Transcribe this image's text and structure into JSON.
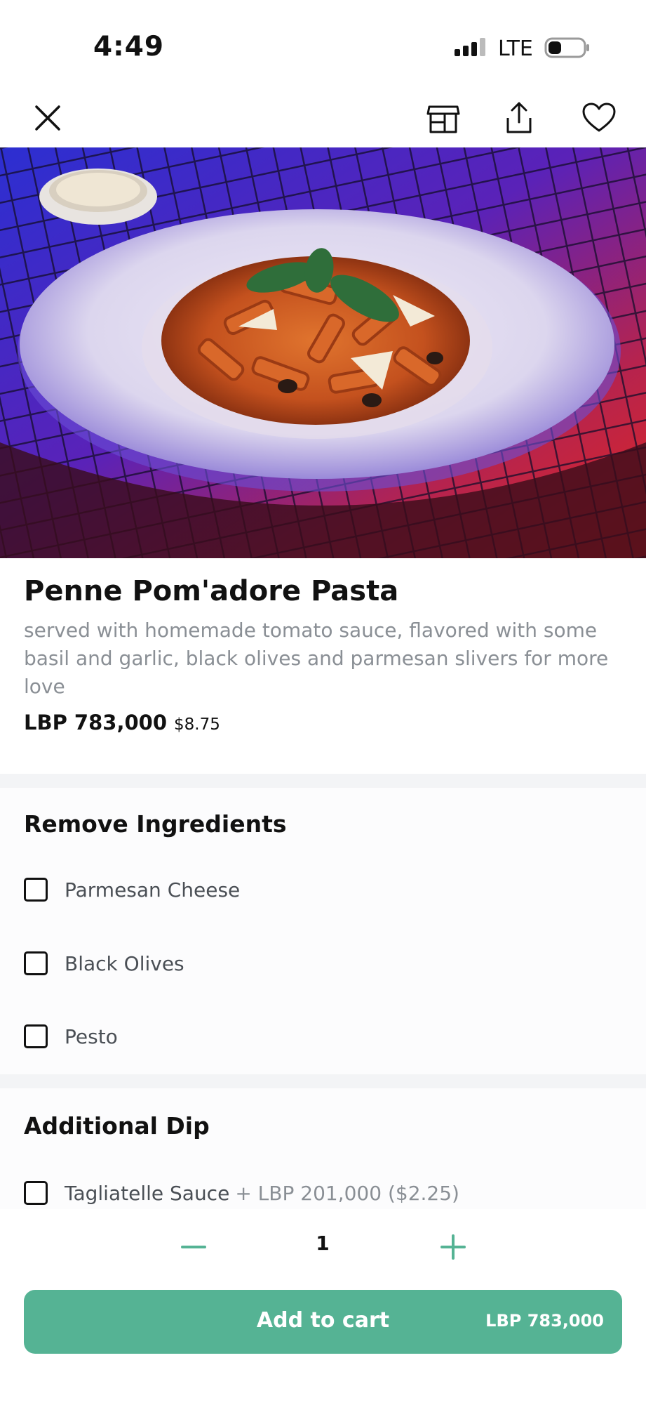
{
  "status_bar": {
    "time": "4:49",
    "network": "LTE"
  },
  "toolbar": {
    "close_icon": "close-icon",
    "store_icon": "store-icon",
    "share_icon": "share-icon",
    "favorite_icon": "heart-icon"
  },
  "item": {
    "title": "Penne Pom'adore Pasta",
    "description": "served with homemade tomato sauce, flavored with some basil and garlic, black olives and parmesan slivers for more love",
    "price_lbp": "LBP 783,000",
    "price_usd": "$8.75"
  },
  "remove_ingredients": {
    "title": "Remove Ingredients",
    "options": [
      {
        "label": "Parmesan Cheese"
      },
      {
        "label": "Black Olives"
      },
      {
        "label": "Pesto"
      }
    ]
  },
  "additional_dip": {
    "title": "Additional Dip",
    "options": [
      {
        "label": "Tagliatelle Sauce",
        "extra": "+ LBP 201,000 ($2.25)"
      }
    ]
  },
  "quantity": {
    "value": "1"
  },
  "cart": {
    "label": "Add to cart",
    "price": "LBP 783,000"
  },
  "colors": {
    "accent": "#55b394",
    "muted_text": "#8a8f95"
  }
}
